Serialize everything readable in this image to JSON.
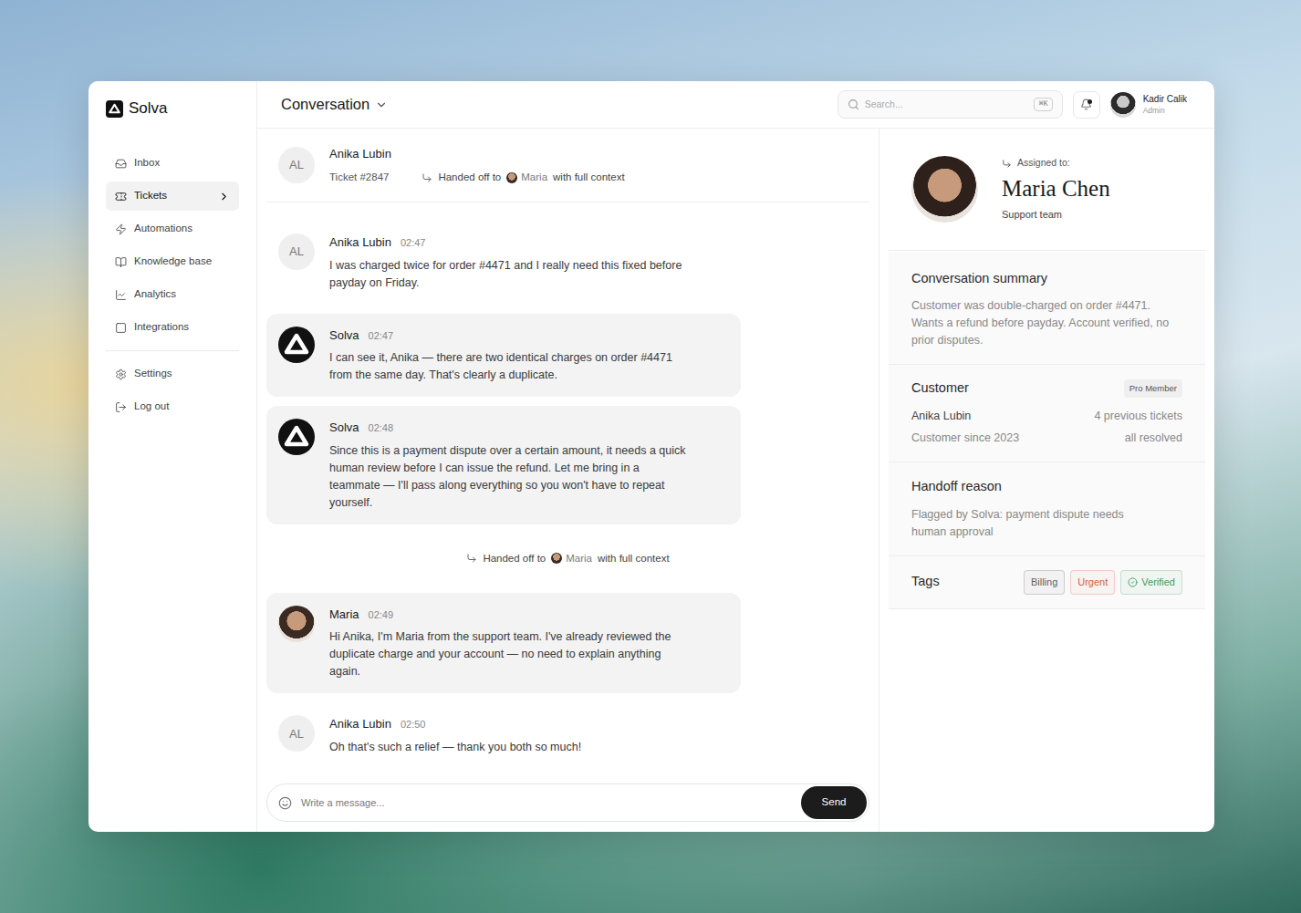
{
  "app": {
    "logo": "Solva"
  },
  "sidebar": {
    "items": [
      {
        "label": "Inbox",
        "selected": false,
        "expandable": false
      },
      {
        "label": "Tickets",
        "selected": true,
        "expandable": true
      },
      {
        "label": "Automations",
        "selected": false,
        "expandable": false
      },
      {
        "label": "Knowledge base",
        "selected": false,
        "expandable": false
      },
      {
        "label": "Analytics",
        "selected": false,
        "expandable": false
      },
      {
        "label": "Integrations",
        "selected": false,
        "expandable": false
      }
    ],
    "bottom_items": [
      {
        "label": "Settings",
        "selected": false
      },
      {
        "label": "Log out",
        "selected": false
      }
    ]
  },
  "topbar": {
    "title": "Conversation",
    "search": {
      "placeholder": "Search...",
      "shortcut": "⌘K"
    },
    "notifications": {
      "unread": true
    },
    "user": {
      "name": "Kadir Calik",
      "role": "Admin"
    }
  },
  "conversation": {
    "header": {
      "initials": "AL",
      "name": "Anika Lubin",
      "ticket": "Ticket #2847",
      "handoff": {
        "prefix": "Handed off to",
        "name": "Maria",
        "suffix": "with full context"
      }
    },
    "messages": [
      {
        "kind": "customer",
        "author": "Anika Lubin",
        "initials": "AL",
        "time": "02:47",
        "text": "I was charged twice for order #4471 and I really need this fixed before payday on Friday."
      },
      {
        "kind": "bot",
        "author": "Solva",
        "time": "02:47",
        "text": "I can see it, Anika — there are two identical charges on order #4471 from the same day. That's clearly a duplicate."
      },
      {
        "kind": "bot",
        "author": "Solva",
        "time": "02:48",
        "text": "Since this is a payment dispute over a certain amount, it needs a quick human review before I can issue the refund. Let me bring in a teammate — I'll pass along everything so you won't have to repeat yourself."
      },
      {
        "kind": "handoff",
        "prefix": "Handed off to",
        "name": "Maria",
        "suffix": "with full context"
      },
      {
        "kind": "agent",
        "author": "Maria",
        "time": "02:49",
        "text": "Hi Anika, I'm Maria from the support team. I've already reviewed the duplicate charge and your account — no need to explain anything again."
      },
      {
        "kind": "customer",
        "author": "Anika Lubin",
        "initials": "AL",
        "time": "02:50",
        "text": "Oh that's such a relief — thank you both so much!"
      }
    ],
    "composer": {
      "placeholder": "Write a message...",
      "send": "Send"
    }
  },
  "details": {
    "assigned": {
      "label": "Assigned to:",
      "name": "Maria Chen",
      "team": "Support team"
    },
    "summary": {
      "title": "Conversation summary",
      "text": "Customer was double-charged on order #4471. Wants a refund before payday. Account verified, no prior disputes."
    },
    "customer": {
      "title": "Customer",
      "badge": "Pro Member",
      "name": "Anika Lubin",
      "tickets": "4 previous tickets",
      "since": "Customer since 2023",
      "status": "all resolved"
    },
    "handoff_reason": {
      "title": "Handoff reason",
      "text": "Flagged by Solva: payment dispute needs human approval"
    },
    "tags": {
      "title": "Tags",
      "items": [
        {
          "label": "Billing",
          "color": "#5f5f5f",
          "checked": false
        },
        {
          "label": "Urgent",
          "color": "#d2603f",
          "checked": false
        },
        {
          "label": "Verified",
          "color": "#3f9a5b",
          "checked": true
        }
      ]
    }
  }
}
